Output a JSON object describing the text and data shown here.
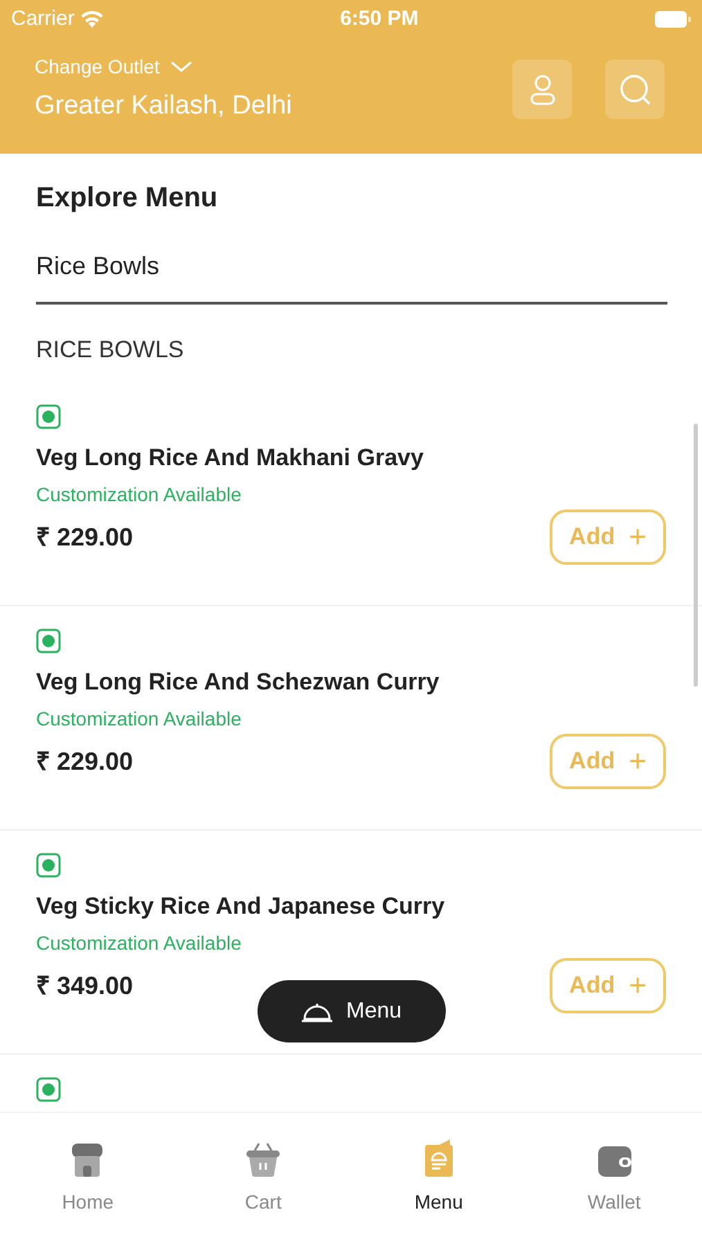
{
  "status_bar": {
    "carrier": "Carrier",
    "time": "6:50 PM"
  },
  "header": {
    "change_label": "Change Outlet",
    "outlet": "Greater Kailash, Delhi"
  },
  "title": "Explore Menu",
  "category_tab": "Rice Bowls",
  "section": "RICE BOWLS",
  "items": [
    {
      "kind": "full",
      "veg": true,
      "name": "Veg Long Rice And Makhani Gravy",
      "note": "Customization Available",
      "price": "₹ 229.00",
      "button": "Add",
      "button_icon": "+"
    },
    {
      "kind": "full",
      "veg": true,
      "name": "Veg Long Rice And Schezwan Curry",
      "note": "Customization Available",
      "price": "₹ 229.00",
      "button": "Add",
      "button_icon": "+"
    },
    {
      "kind": "full",
      "veg": true,
      "name": "Veg Sticky Rice And Japanese Curry",
      "note": "Customization Available",
      "price": "₹ 349.00",
      "button": "Add",
      "button_icon": "+"
    },
    {
      "kind": "partial",
      "veg": true
    }
  ],
  "floating_button": "Menu",
  "tabs": [
    {
      "label": "Home",
      "selected": false
    },
    {
      "label": "Cart",
      "selected": false
    },
    {
      "label": "Menu",
      "selected": true
    },
    {
      "label": "Wallet",
      "selected": false
    }
  ]
}
